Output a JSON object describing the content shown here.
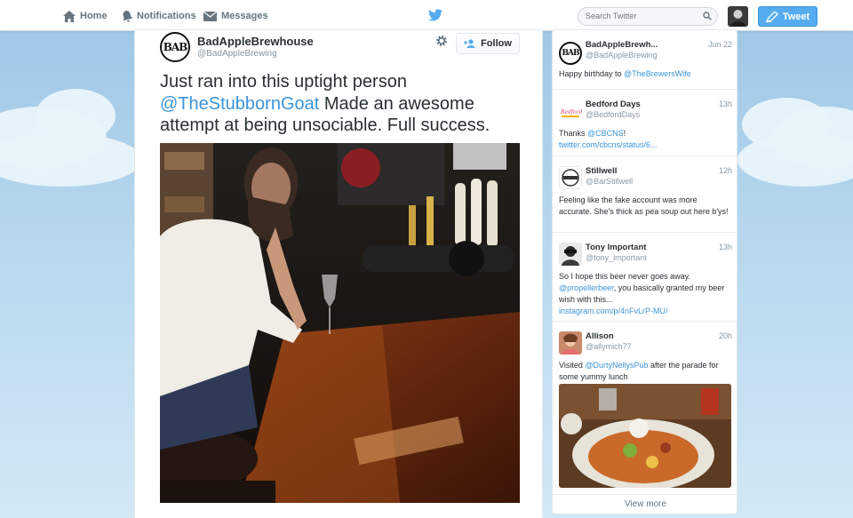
{
  "topbar": {
    "home_label": "Home",
    "notifications_label": "Notifications",
    "messages_label": "Messages",
    "search_placeholder": "Search Twitter",
    "tweet_button_label": "Tweet"
  },
  "tweet": {
    "user_name": "BadAppleBrewhouse",
    "user_handle": "@BadAppleBrewing",
    "logo_text": "BAB",
    "follow_label": "Follow",
    "text_before": "Just ran into this uptight person ",
    "mention": "@TheStubbornGoat",
    "text_after": " Made an awesome attempt at being unsociable. Full success."
  },
  "sidebar": {
    "items": [
      {
        "name": "BadAppleBrewh...",
        "handle": "@BadAppleBrewing",
        "time": "Jun 22",
        "text_before": "Happy birthday to ",
        "link": "@TheBrewersWife",
        "text_after": ""
      },
      {
        "name": "Bedford Days",
        "handle": "@BedfordDays",
        "time": "13h",
        "text_before": "Thanks ",
        "link": "@CBCNS",
        "text_after": "!",
        "url": "twitter.com/cbcns/status/6..."
      },
      {
        "name": "Stillwell",
        "handle": "@BarStillwell",
        "time": "12h",
        "text": "Feeling like the fake account was more accurate. She's thick as pea soup out here b'ys!"
      },
      {
        "name": "Tony Important",
        "handle": "@tony_important",
        "time": "13h",
        "line1": "So I hope this beer never goes away.",
        "link": "@propellerbeer",
        "text_after": ", you basically granted my beer wish with this...",
        "url": "instagram.com/p/4nFvLrP-MU/"
      },
      {
        "name": "Allison",
        "handle": "@allymich77",
        "time": "20h",
        "text_before": "Visited ",
        "link": "@DurtyNellysPub",
        "text_after": " after the parade for some yummy lunch"
      }
    ],
    "view_more": "View more"
  },
  "colors": {
    "accent": "#55acee",
    "link": "#3b94d9"
  },
  "icons": [
    "home-icon",
    "bell-icon",
    "envelope-icon",
    "twitter-bird-icon",
    "search-icon",
    "compose-icon",
    "gear-icon",
    "follow-person-icon"
  ]
}
